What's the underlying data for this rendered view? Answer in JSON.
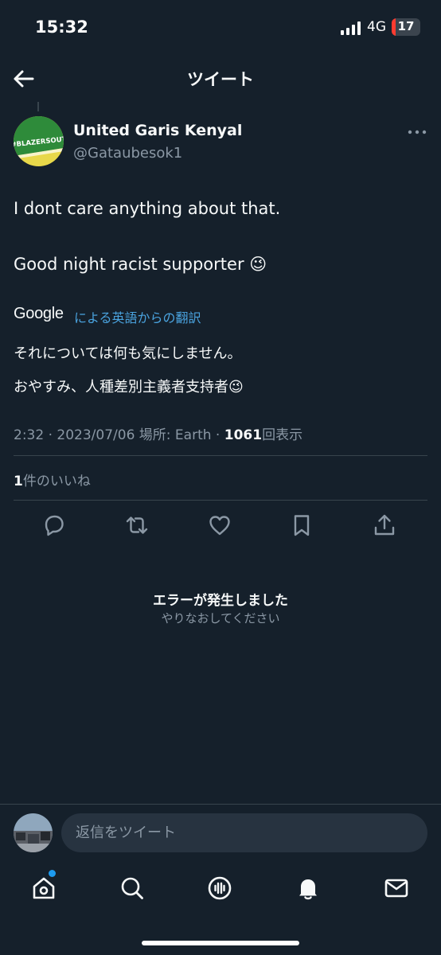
{
  "status_bar": {
    "time": "15:32",
    "network": "4G",
    "battery": "17",
    "battery_color": "#ff3b30"
  },
  "header": {
    "title": "ツイート",
    "back_icon": "arrow-left-icon"
  },
  "tweet": {
    "author": {
      "display_name": "United Garis Kenyal",
      "handle": "@Gataubesok1",
      "avatar_text": "#BLAZERSOUT",
      "avatar_colors": [
        "#2e8b3a",
        "#e8d84a"
      ]
    },
    "text_line1": "I dont care anything about that.",
    "text_line2": "Good night racist supporter 😉",
    "translation": {
      "provider": "Google",
      "label": "による英語からの翻訳",
      "line1": "それについては何も気にしません。",
      "line2": "おやすみ、人種差別主義者支持者😉"
    },
    "meta": {
      "time": "2:32",
      "date": "2023/07/06",
      "location_label": "場所: Earth",
      "views_count": "1061",
      "views_label": "回表示"
    },
    "likes": {
      "count": "1",
      "label": "件のいいね"
    },
    "actions": [
      "reply-icon",
      "retweet-icon",
      "like-icon",
      "bookmark-icon",
      "share-icon"
    ]
  },
  "error": {
    "title": "エラーが発生しました",
    "subtitle": "やりなおしてください"
  },
  "reply_bar": {
    "placeholder": "返信をツイート"
  },
  "bottom_nav": [
    "home-icon",
    "search-icon",
    "spaces-icon",
    "notifications-icon",
    "messages-icon"
  ],
  "accent_color": "#1d9bf0",
  "link_color": "#4aa3df",
  "background_color": "#15202b"
}
